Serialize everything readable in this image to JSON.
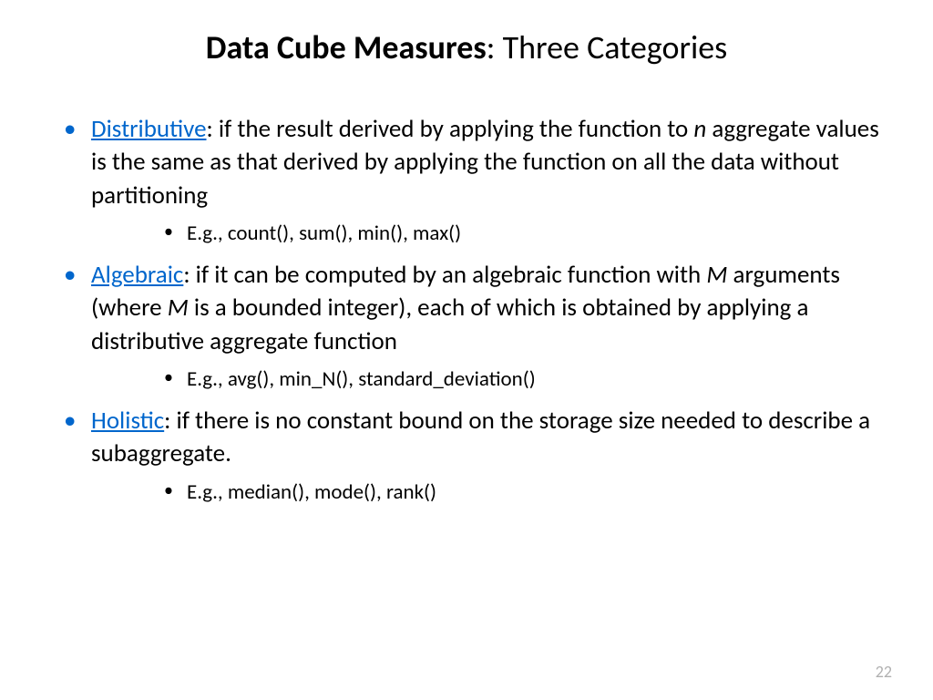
{
  "title": {
    "bold": "Data Cube Measures",
    "rest": ": Three Categories"
  },
  "bullets": [
    {
      "term": "Distributive",
      "body_parts": [
        ": if the result derived by applying the function to ",
        " aggregate values is the same as that derived by applying the function on all the data without partitioning"
      ],
      "italic1": "n",
      "example": "E.g., count(), sum(), min(), max()"
    },
    {
      "term": "Algebraic",
      "body_parts": [
        ": if it can be computed by an algebraic function with ",
        " arguments (where ",
        " is a bounded integer), each of which is obtained by applying a distributive aggregate function"
      ],
      "italic1": "M",
      "italic2": "M",
      "example": "E.g.,  avg(), min_N(), standard_deviation()"
    },
    {
      "term": "Holistic",
      "body_parts": [
        ": if there is no constant bound on the storage size needed to describe a subaggregate."
      ],
      "example": "E.g., median(), mode(), rank()"
    }
  ],
  "page_number": "22"
}
